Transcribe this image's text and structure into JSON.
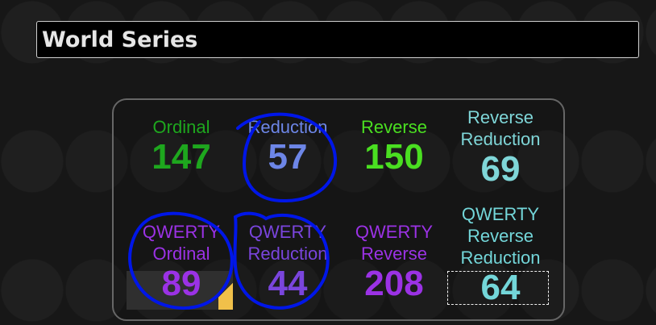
{
  "title": "World Series",
  "cards": [
    {
      "name": "ordinal",
      "label": "Ordinal",
      "value": "147",
      "color": "#1ea71e"
    },
    {
      "name": "reduction",
      "label": "Reduction",
      "value": "57",
      "color": "#6d86e7"
    },
    {
      "name": "reverse",
      "label": "Reverse",
      "value": "150",
      "color": "#4adf21"
    },
    {
      "name": "reverse-reduction",
      "label": "Reverse\nReduction",
      "value": "69",
      "color": "#7fd6d8"
    },
    {
      "name": "qwerty-ordinal",
      "label": "QWERTY\nOrdinal",
      "value": "89",
      "color": "#9b32e5"
    },
    {
      "name": "qwerty-reduction",
      "label": "QWERTY\nReduction",
      "value": "44",
      "color": "#7a45dd"
    },
    {
      "name": "qwerty-reverse",
      "label": "QWERTY\nReverse",
      "value": "208",
      "color": "#9b32e5"
    },
    {
      "name": "qwerty-reverse-reduction",
      "label": "QWERTY\nReverse\nReduction",
      "value": "64",
      "color": "#73d6d9"
    }
  ]
}
